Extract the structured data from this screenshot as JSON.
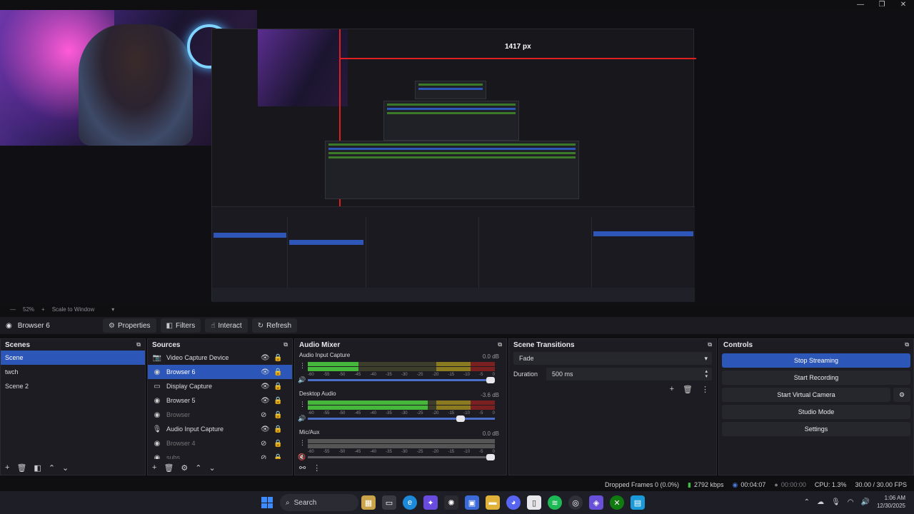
{
  "window": {
    "controls": [
      "—",
      "❐",
      "✕"
    ]
  },
  "preview": {
    "measure_label": "1417 px"
  },
  "zoom_bar": {
    "zoom": "52%",
    "scale_label": "Scale to Window"
  },
  "context_bar": {
    "source_name": "Browser 6",
    "properties": "Properties",
    "filters": "Filters",
    "interact": "Interact",
    "refresh": "Refresh"
  },
  "scenes": {
    "title": "Scenes",
    "items": [
      "Scene",
      "twch",
      "Scene 2"
    ]
  },
  "sources": {
    "title": "Sources",
    "items": [
      {
        "name": "Video Capture Device",
        "icon": "camera-icon"
      },
      {
        "name": "Browser 6",
        "icon": "globe-icon"
      },
      {
        "name": "Display Capture",
        "icon": "monitor-icon"
      },
      {
        "name": "Browser 5",
        "icon": "globe-icon"
      },
      {
        "name": "Browser",
        "icon": "globe-icon"
      },
      {
        "name": "Audio Input Capture",
        "icon": "mic-icon"
      },
      {
        "name": "Browser 4",
        "icon": "globe-icon"
      },
      {
        "name": "subs",
        "icon": "globe-icon"
      }
    ]
  },
  "audio_mixer": {
    "title": "Audio Mixer",
    "ticks": [
      "-60",
      "-55",
      "-50",
      "-45",
      "-40",
      "-35",
      "-30",
      "-25",
      "-20",
      "-15",
      "-10",
      "-5",
      "0"
    ],
    "channels": [
      {
        "name": "Audio Input Capture",
        "db": "0.0 dB",
        "level": 0.27,
        "volume": 1.0
      },
      {
        "name": "Desktop Audio",
        "db": "-3.6 dB",
        "level": 0.64,
        "volume": 0.83
      },
      {
        "name": "Mic/Aux",
        "db": "0.0 dB",
        "level": 0.0,
        "volume": 1.0
      }
    ]
  },
  "transitions": {
    "title": "Scene Transitions",
    "selected": "Fade",
    "duration_label": "Duration",
    "duration_value": "500 ms"
  },
  "controls": {
    "title": "Controls",
    "stop_streaming": "Stop Streaming",
    "start_recording": "Start Recording",
    "start_virtual_camera": "Start Virtual Camera",
    "studio_mode": "Studio Mode",
    "settings": "Settings"
  },
  "status": {
    "dropped_frames": "Dropped Frames 0 (0.0%)",
    "bitrate": "2792 kbps",
    "stream_time": "00:04:07",
    "record_time": "00:00:00",
    "cpu": "CPU: 1.3%",
    "fps": "30.00 / 30.00 FPS"
  },
  "taskbar": {
    "search": "Search",
    "time": "1:06 AM",
    "date": "12/30/2025"
  },
  "colors": {
    "accent": "#2c56b8",
    "meter_green": "#45b83c",
    "signal_green": "#3ec13e"
  }
}
